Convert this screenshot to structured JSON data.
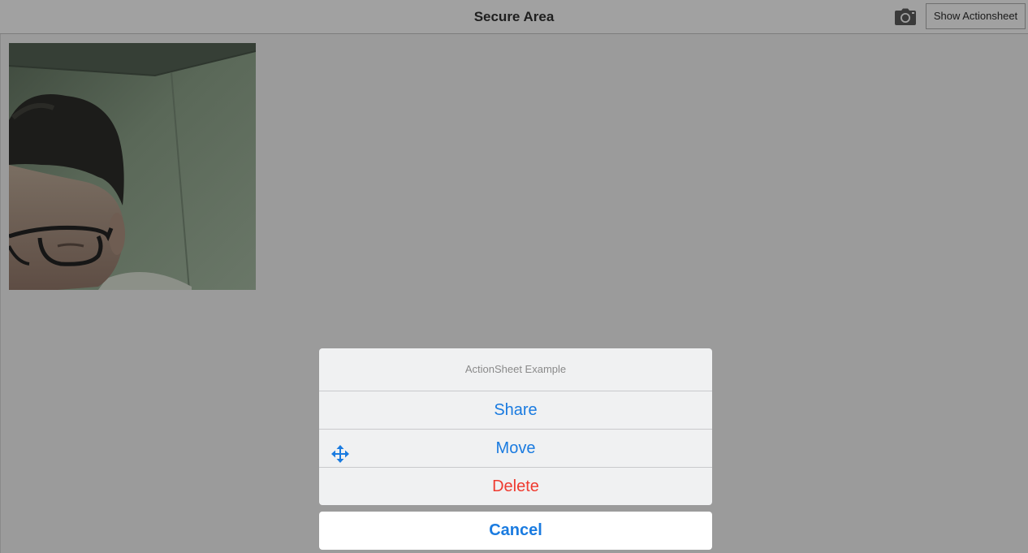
{
  "navbar": {
    "title": "Secure Area",
    "camera_icon": "camera-icon",
    "show_actionsheet_label": "Show Actionsheet"
  },
  "preview": {
    "description_icon": "camera-preview-photo"
  },
  "action_sheet": {
    "title": "ActionSheet Example",
    "items": [
      {
        "label": "Share",
        "icon": null,
        "style": "default"
      },
      {
        "label": "Move",
        "icon": "move-arrows-icon",
        "style": "default"
      },
      {
        "label": "Delete",
        "icon": null,
        "style": "destructive"
      }
    ],
    "cancel_label": "Cancel"
  },
  "colors": {
    "accent": "#1a7be0",
    "destructive": "#ef3b30",
    "dimmed_background": "#9b9b9b"
  }
}
